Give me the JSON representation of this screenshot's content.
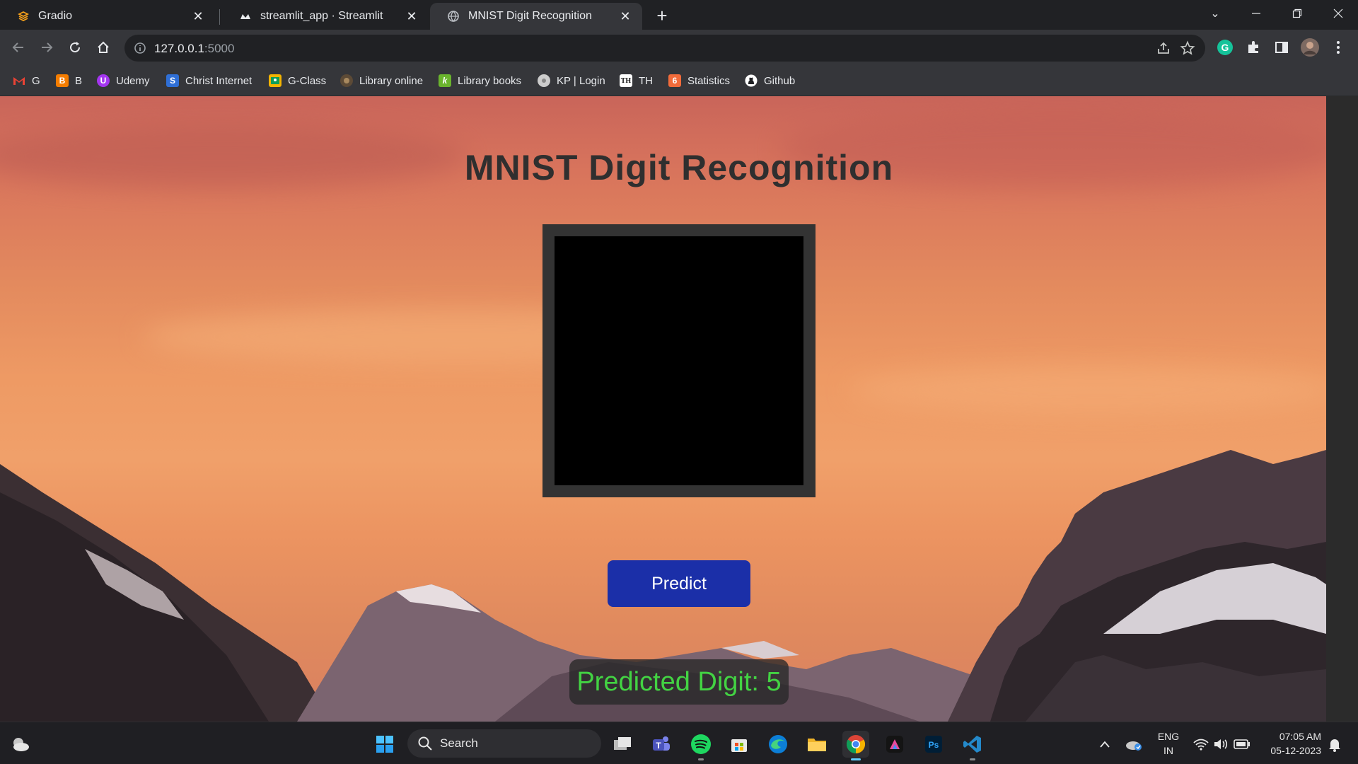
{
  "browser": {
    "tabs": [
      {
        "title": "Gradio",
        "icon": "gradio-icon"
      },
      {
        "title": "streamlit_app · Streamlit",
        "icon": "streamlit-icon"
      },
      {
        "title": "MNIST Digit Recognition",
        "icon": "globe-icon"
      }
    ],
    "active_tab": 2,
    "url_host": "127.0.0.1",
    "url_port": ":5000",
    "bookmarks": [
      {
        "label": "G",
        "icon": "gmail-icon",
        "color": "#ea4335"
      },
      {
        "label": "B",
        "icon": "blogger-icon",
        "color": "#f57d00"
      },
      {
        "label": "Udemy",
        "icon": "udemy-icon",
        "color": "#a435f0"
      },
      {
        "label": "Christ Internet",
        "icon": "christ-internet-icon",
        "color": "#2f6fd6"
      },
      {
        "label": "G-Class",
        "icon": "google-classroom-icon",
        "color": "#f4b400"
      },
      {
        "label": "Library online",
        "icon": "library-online-icon",
        "color": "#8d6e4a"
      },
      {
        "label": "Library books",
        "icon": "koha-library-icon",
        "color": "#6ab42d"
      },
      {
        "label": "KP | Login",
        "icon": "kp-login-icon",
        "color": "#cccccc"
      },
      {
        "label": "TH",
        "icon": "the-hindu-icon",
        "color": "#ffffff"
      },
      {
        "label": "Statistics",
        "icon": "statistics-icon",
        "color": "#f26b3a"
      },
      {
        "label": "Github",
        "icon": "github-icon",
        "color": "#ffffff"
      }
    ]
  },
  "page": {
    "title": "MNIST Digit Recognition",
    "predict_button": "Predict",
    "result_label": "Predicted Digit: 5"
  },
  "taskbar": {
    "search_placeholder": "Search",
    "apps": [
      "windows-start-icon",
      "task-view-icon",
      "teams-icon",
      "spotify-icon",
      "microsoft-store-icon",
      "edge-icon",
      "file-explorer-icon",
      "chrome-icon",
      "affinity-icon",
      "photoshop-icon",
      "vscode-icon"
    ],
    "lang_line1": "ENG",
    "lang_line2": "IN",
    "time": "07:05 AM",
    "date": "05-12-2023"
  },
  "colors": {
    "predict_button": "#1b2fa8",
    "result_text": "#43d343",
    "heading_text": "#2f2f2f"
  }
}
